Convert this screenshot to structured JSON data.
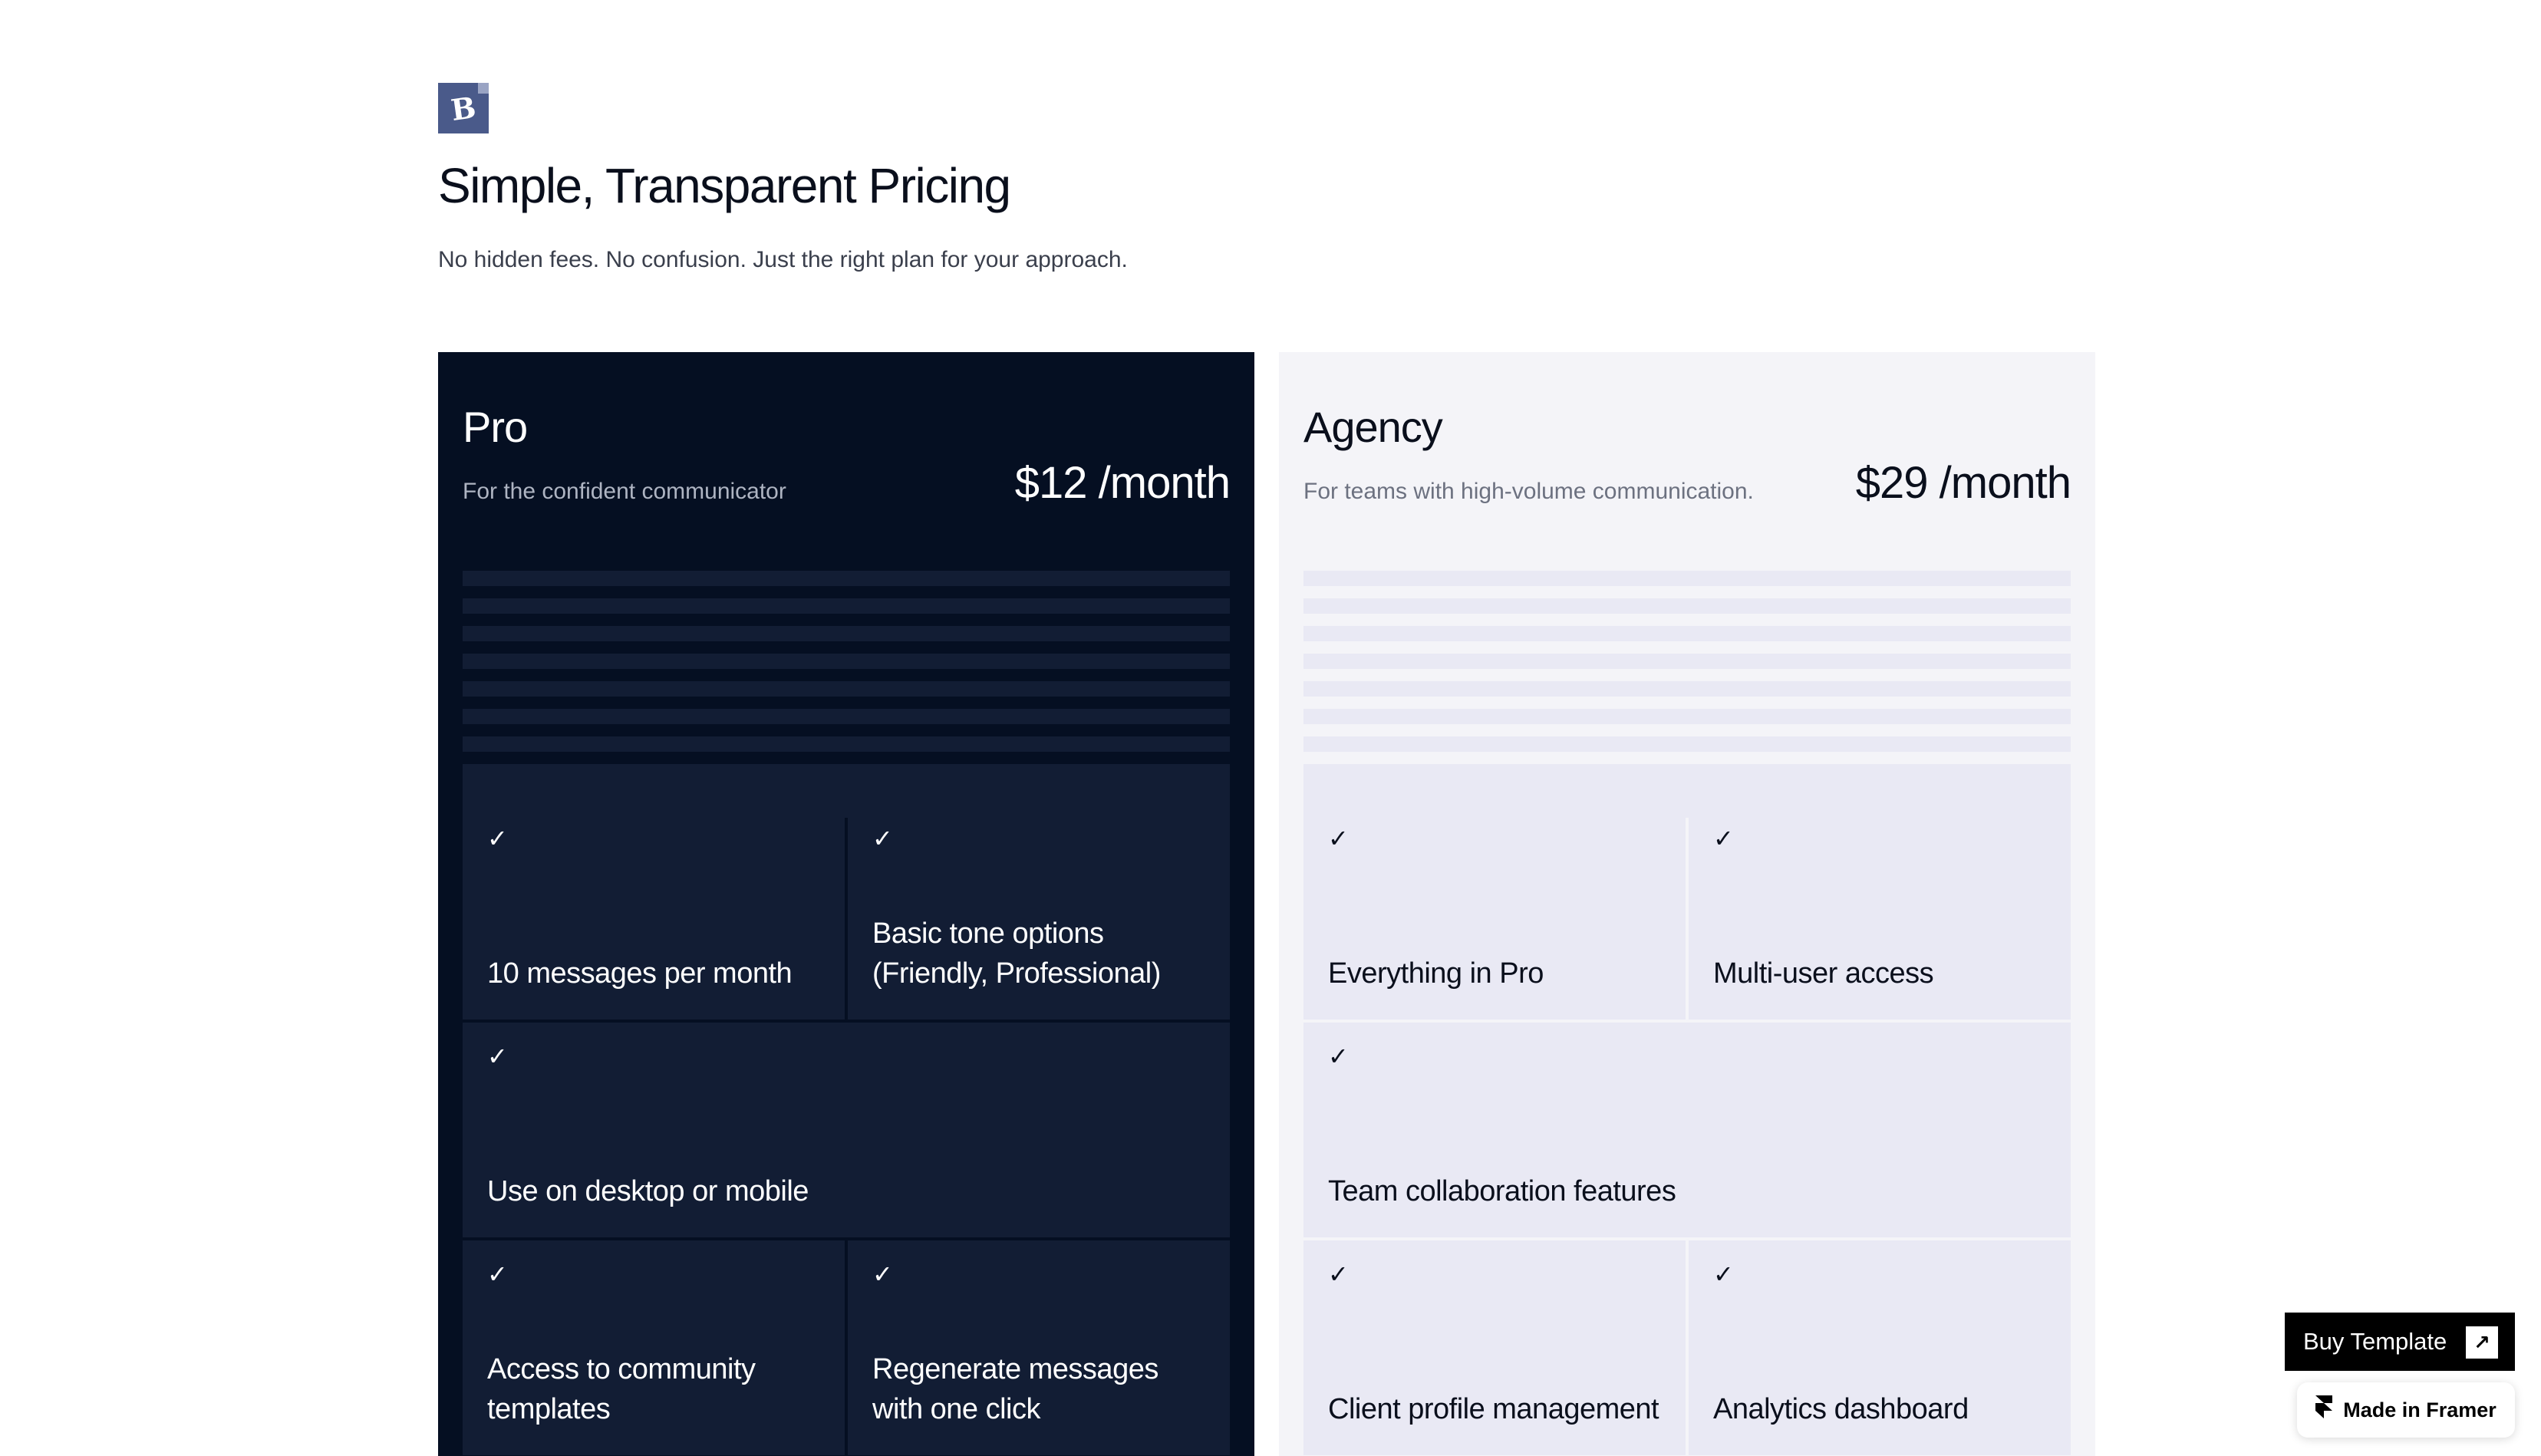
{
  "header": {
    "logo_icon": "bookmark-b-logo",
    "title": "Simple, Transparent Pricing",
    "subtitle": "No hidden fees. No confusion. Just the right plan for your approach."
  },
  "plans": [
    {
      "name": "Pro",
      "description": "For the confident communicator",
      "price": "$12 /month",
      "background": "#050f22",
      "features": [
        "10 messages per month",
        "Basic tone options (Friendly, Professional)",
        "Use on desktop or mobile",
        "Access to community templates",
        "Regenerate messages with one click"
      ]
    },
    {
      "name": "Agency",
      "description": "For teams with high-volume communication.",
      "price": "$29 /month",
      "background": "#f4f4f8",
      "features": [
        "Everything in Pro",
        "Multi-user access",
        "Team collaboration features",
        "Client profile management",
        "Analytics dashboard"
      ]
    }
  ],
  "check_icon": "checkmark-icon",
  "check_glyph": "✓",
  "floating": {
    "buy_label": "Buy Template",
    "buy_icon": "arrow-up-right-icon",
    "buy_glyph": "↗",
    "framer_label": "Made in Framer",
    "framer_icon": "framer-logo-icon"
  }
}
